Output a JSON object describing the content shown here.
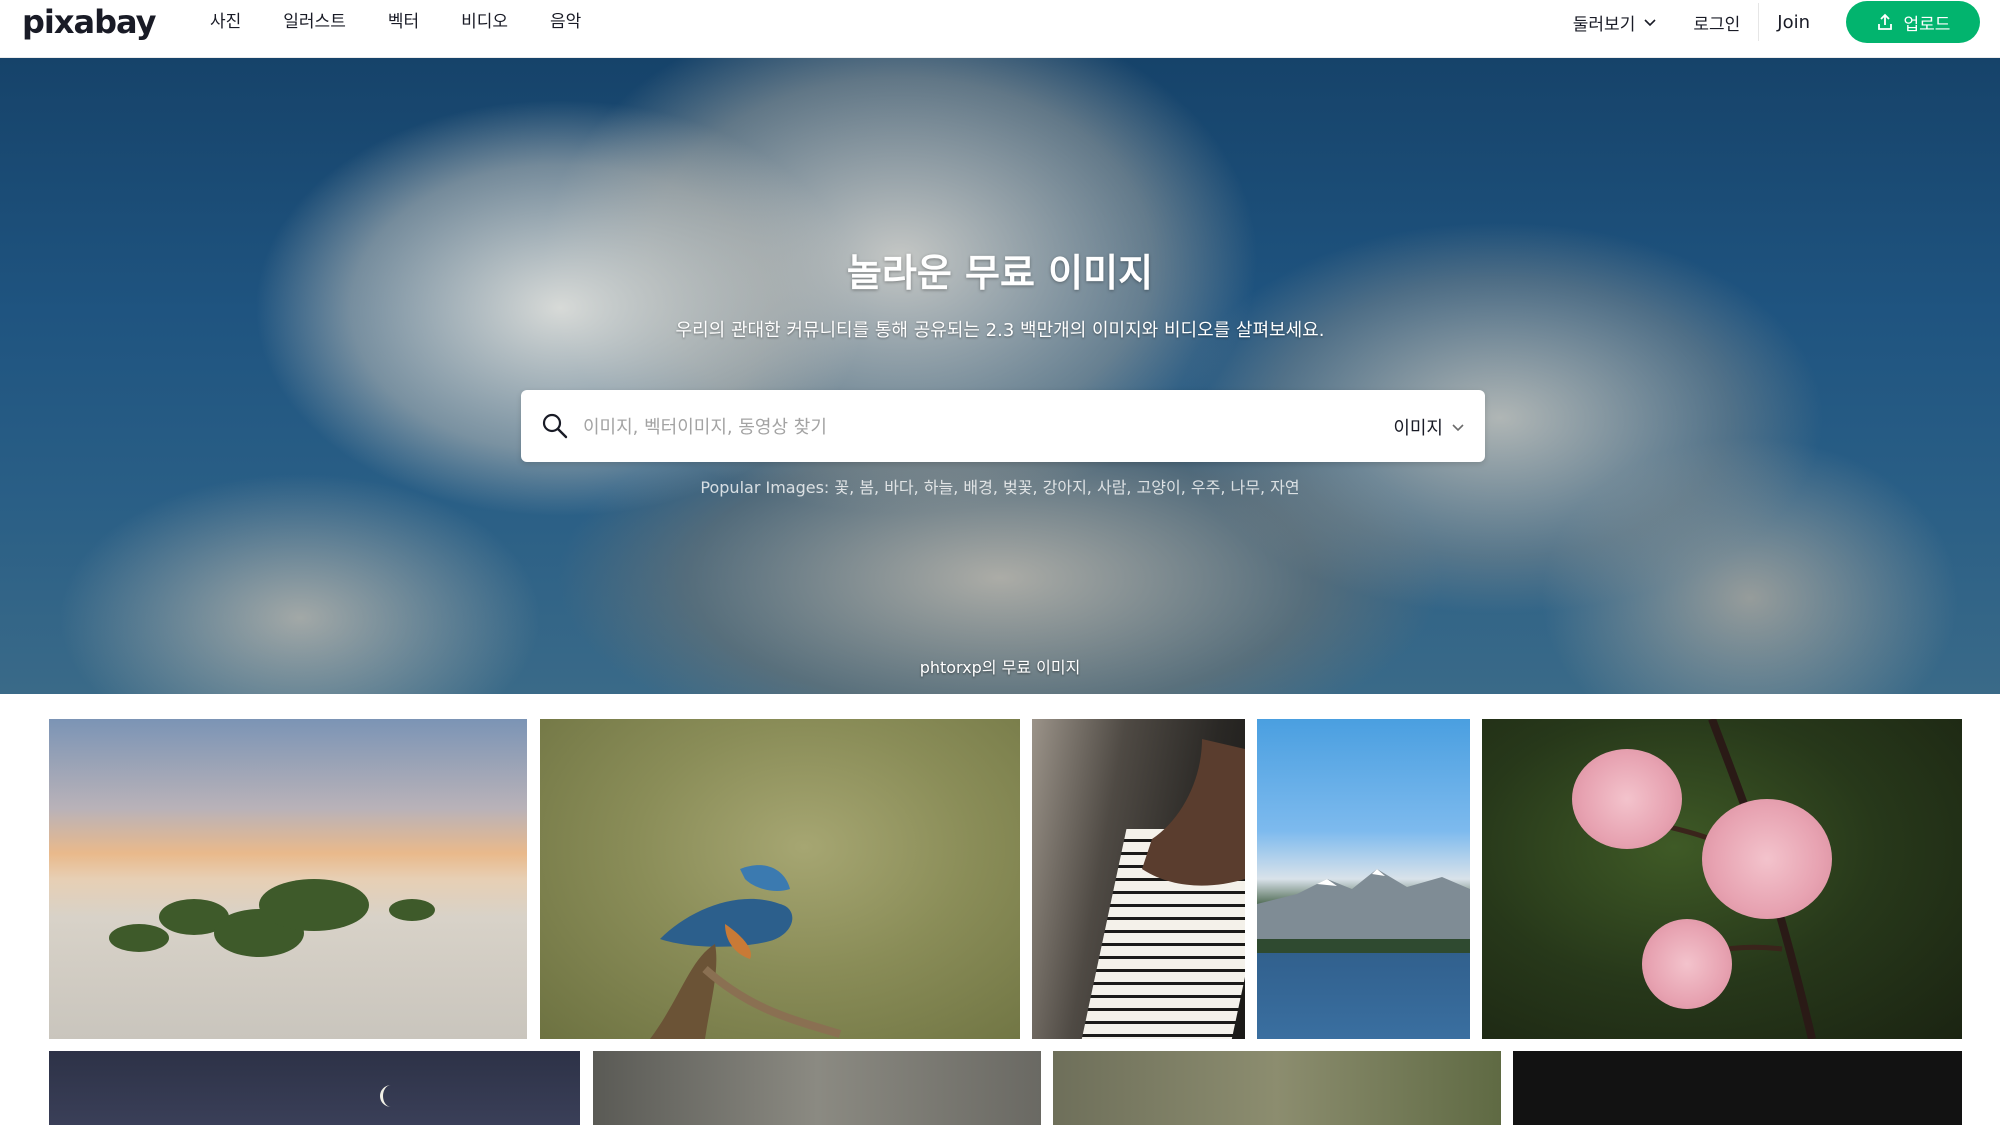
{
  "header": {
    "logo": "pixabay",
    "nav": [
      "사진",
      "일러스트",
      "벡터",
      "비디오",
      "음악"
    ],
    "explore": "둘러보기",
    "login": "로그인",
    "join": "Join",
    "upload": "업로드"
  },
  "hero": {
    "title": "놀라운 무료 이미지",
    "subtitle": "우리의 관대한 커뮤니티를 통해 공유되는 2.3 백만개의 이미지와 비디오를 살펴보세요.",
    "search_placeholder": "이미지, 벡터이미지, 동영상 찾기",
    "search_value": "",
    "search_type": "이미지",
    "popular": "Popular Images: 꽃, 봄, 바다, 하늘, 배경, 벚꽃, 강아지, 사람, 고양이, 우주, 나무, 자연",
    "credit": "phtorxp의 무료 이미지"
  },
  "colors": {
    "brand_green": "#02b46e",
    "text": "#191b26"
  },
  "icons": {
    "search": "search-icon",
    "chevron": "chevron-down-icon",
    "upload": "upload-icon"
  }
}
